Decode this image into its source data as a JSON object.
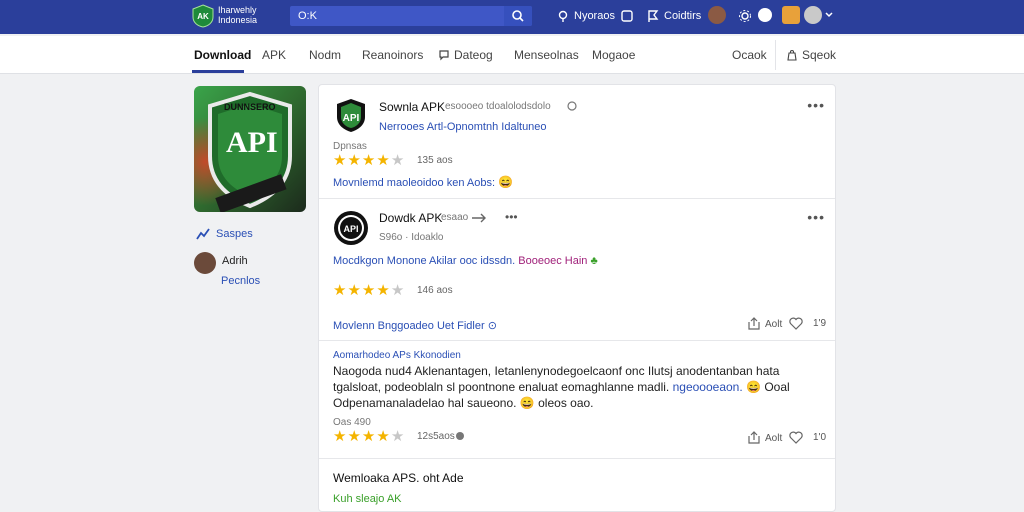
{
  "header": {
    "logo_text_line1": "Iharwehly",
    "logo_text_line2": "Indonesia",
    "search_value": "O:K",
    "items": [
      {
        "label": "Nyoraos",
        "icon": "location-icon"
      },
      {
        "label": "",
        "icon": "bookmark-icon"
      },
      {
        "label": "Coidtirs",
        "icon": "flag-icon"
      },
      {
        "label": "",
        "icon": "settings-icon"
      }
    ]
  },
  "nav": {
    "tabs": [
      "Download",
      "APK",
      "Nodm",
      "Reanoinors",
      "Dateog",
      "Menseolnas",
      "Mogaoe"
    ],
    "right_items": [
      "Ocaok",
      "Sqeok"
    ]
  },
  "sidebar": {
    "thumb_label_top": "DUNNSERO",
    "thumb_label_main": "API",
    "share_label": "Saspes",
    "user_name": "Adrih",
    "user_link": "Pecnlos"
  },
  "feed": {
    "posts": [
      {
        "title": "Sownla APK",
        "meta": "esoooeo tdoalolodsdolo",
        "link": "Nerrooes Artl-Opnomtnh Idaltuneo",
        "date": "Dpnsas",
        "rating": 4,
        "rating_count": "135 aos",
        "footer_link": "Movnlemd maoleoidoo ken Aobs:"
      },
      {
        "title": "Dowdk APK",
        "meta": "esaao",
        "sub": "S96o · Idoaklo",
        "colored_text": "Mocdkgon Monone Akilar ooc idssdn.",
        "colored_text2": "Booeoec Hain",
        "rating": 4,
        "rating_count": "146 aos",
        "footer_link": "Movlenn Bnggoadeo Uet Fidler",
        "share_label": "Aolt",
        "like_count": "1'9"
      },
      {
        "header_link": "Aomarhodeo APs Kkonodien",
        "body": "Naogoda nud4 Aklenantagen, Ietanlenynodegoelcaonf onc Ilutsj anodentanban hata tgalsloat, podeoblaln sl poontnone enaluat eomaghlanne madli.",
        "body_link": "ngeoooeaon.",
        "body_tail": "Ooal  Odpenamanaladelao hal saueono.",
        "body_tail2": "oleos oao.",
        "date": "Oas 490",
        "rating": 4,
        "rating_count": "12s5aos",
        "share_label": "Aolt",
        "like_count": "1'0"
      },
      {
        "title": "Wemloaka APS. oht Ade",
        "link": "Kuh sleajo AK"
      }
    ]
  },
  "colors": {
    "header_bg": "#2b3f9b",
    "accent_link": "#2a4fb5",
    "star": "#f4b400",
    "green_link": "#3aa02a",
    "magenta_text": "#a0217a"
  }
}
